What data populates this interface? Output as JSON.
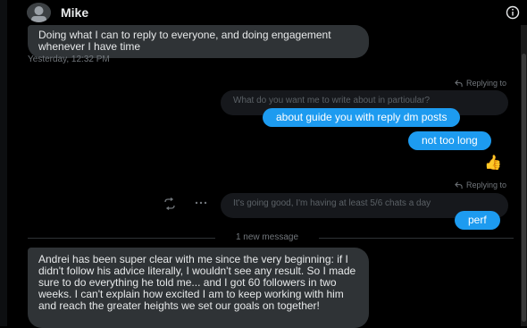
{
  "header": {
    "contact_name": "Mike"
  },
  "messages": {
    "in_1": "Doing what I can to reply to everyone, and doing engagement whenever I have time",
    "in_1_time": "Yesterday, 12:32 PM",
    "reply_label_1": "Replying to",
    "quoted_1": "What do you want me to write about in partioular?",
    "out_1": "about guide you with reply dm posts",
    "out_2": "not too long",
    "reaction_1": "👍",
    "reply_label_2": "Replying to",
    "quoted_2": "It's going good, I'm having at least 5/6 chats a day",
    "out_3": "perf",
    "new_message_label": "1 new message",
    "in_2": "Andrei has been super clear with me since the very beginning: if I didn't follow his advice literally, I wouldn't see any result. So I made sure to do everything he told me... and I got 60 followers in two weeks. I can't explain how excited I am to keep working with him and reach the greater heights we set our goals on together!"
  },
  "icons": {
    "info": "info-icon",
    "reply": "reply-arrow-icon",
    "react": "add-reaction-icon",
    "more": "more-icon"
  },
  "colors": {
    "outgoing_bubble": "#1d9bf0",
    "incoming_bubble": "#2f3336",
    "background": "#000000"
  }
}
